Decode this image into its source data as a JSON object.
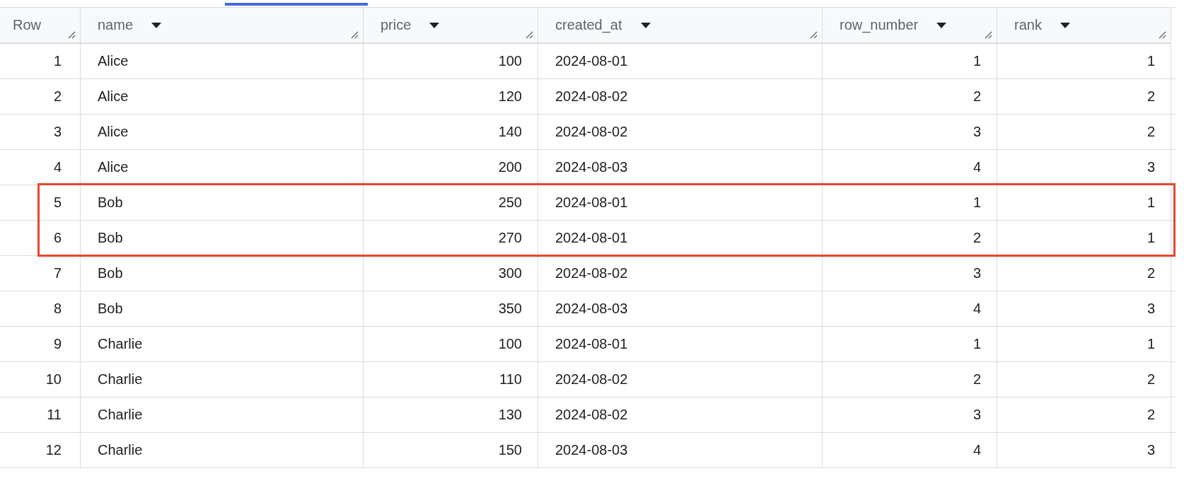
{
  "table": {
    "row_header": "Row",
    "columns": [
      {
        "label": "name",
        "kind": "text"
      },
      {
        "label": "price",
        "kind": "number"
      },
      {
        "label": "created_at",
        "kind": "text"
      },
      {
        "label": "row_number",
        "kind": "number"
      },
      {
        "label": "rank",
        "kind": "number"
      }
    ],
    "rows": [
      {
        "row": "1",
        "cells": [
          "Alice",
          "100",
          "2024-08-01",
          "1",
          "1"
        ],
        "highlighted": false
      },
      {
        "row": "2",
        "cells": [
          "Alice",
          "120",
          "2024-08-02",
          "2",
          "2"
        ],
        "highlighted": false
      },
      {
        "row": "3",
        "cells": [
          "Alice",
          "140",
          "2024-08-02",
          "3",
          "2"
        ],
        "highlighted": false
      },
      {
        "row": "4",
        "cells": [
          "Alice",
          "200",
          "2024-08-03",
          "4",
          "3"
        ],
        "highlighted": false
      },
      {
        "row": "5",
        "cells": [
          "Bob",
          "250",
          "2024-08-01",
          "1",
          "1"
        ],
        "highlighted": true
      },
      {
        "row": "6",
        "cells": [
          "Bob",
          "270",
          "2024-08-01",
          "2",
          "1"
        ],
        "highlighted": true
      },
      {
        "row": "7",
        "cells": [
          "Bob",
          "300",
          "2024-08-02",
          "3",
          "2"
        ],
        "highlighted": false
      },
      {
        "row": "8",
        "cells": [
          "Bob",
          "350",
          "2024-08-03",
          "4",
          "3"
        ],
        "highlighted": false
      },
      {
        "row": "9",
        "cells": [
          "Charlie",
          "100",
          "2024-08-01",
          "1",
          "1"
        ],
        "highlighted": false
      },
      {
        "row": "10",
        "cells": [
          "Charlie",
          "110",
          "2024-08-02",
          "2",
          "2"
        ],
        "highlighted": false
      },
      {
        "row": "11",
        "cells": [
          "Charlie",
          "130",
          "2024-08-02",
          "3",
          "2"
        ],
        "highlighted": false
      },
      {
        "row": "12",
        "cells": [
          "Charlie",
          "150",
          "2024-08-03",
          "4",
          "3"
        ],
        "highlighted": false
      }
    ]
  }
}
